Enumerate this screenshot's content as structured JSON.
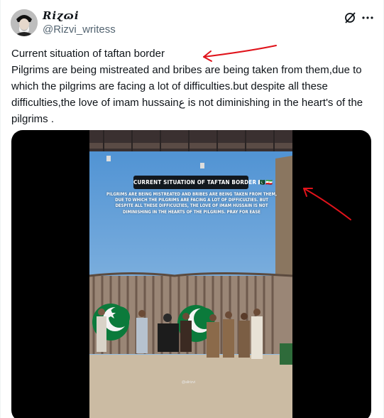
{
  "author": {
    "display_name": "Riɀɷi",
    "handle": "@Rizvi_writess"
  },
  "header_icons": {
    "grok": "grok-icon",
    "more": "more-icon"
  },
  "tweet": {
    "lines": [
      "Current situation of taftan border",
      "Pilgrims are being mistreated and bribes are being taken from them,due to which the pilgrims are facing a lot of difficulties.but despite all these difficulties,the love of imam hussainع is not diminishing in the heart's of the pilgrims ."
    ]
  },
  "media": {
    "overlay_title": "CURRENT SITUATION OF TAFTAN BORDER 🇵🇰🇮🇷",
    "overlay_body": "Pilgrims are being mistreated and bribes are being taken from them, due to which the pilgrims are facing a lot of difficulties. But despite all these difficulties, the love of Imam Hussain is not diminishing in the hearts of the pilgrims. Pray for ease",
    "watermark": "@alirizvi"
  },
  "colors": {
    "text": "#0f1419",
    "muted": "#536471",
    "annotation_red": "#e0131b",
    "sky": "#6ea5d8",
    "flag_green": "#0b7a3b"
  }
}
